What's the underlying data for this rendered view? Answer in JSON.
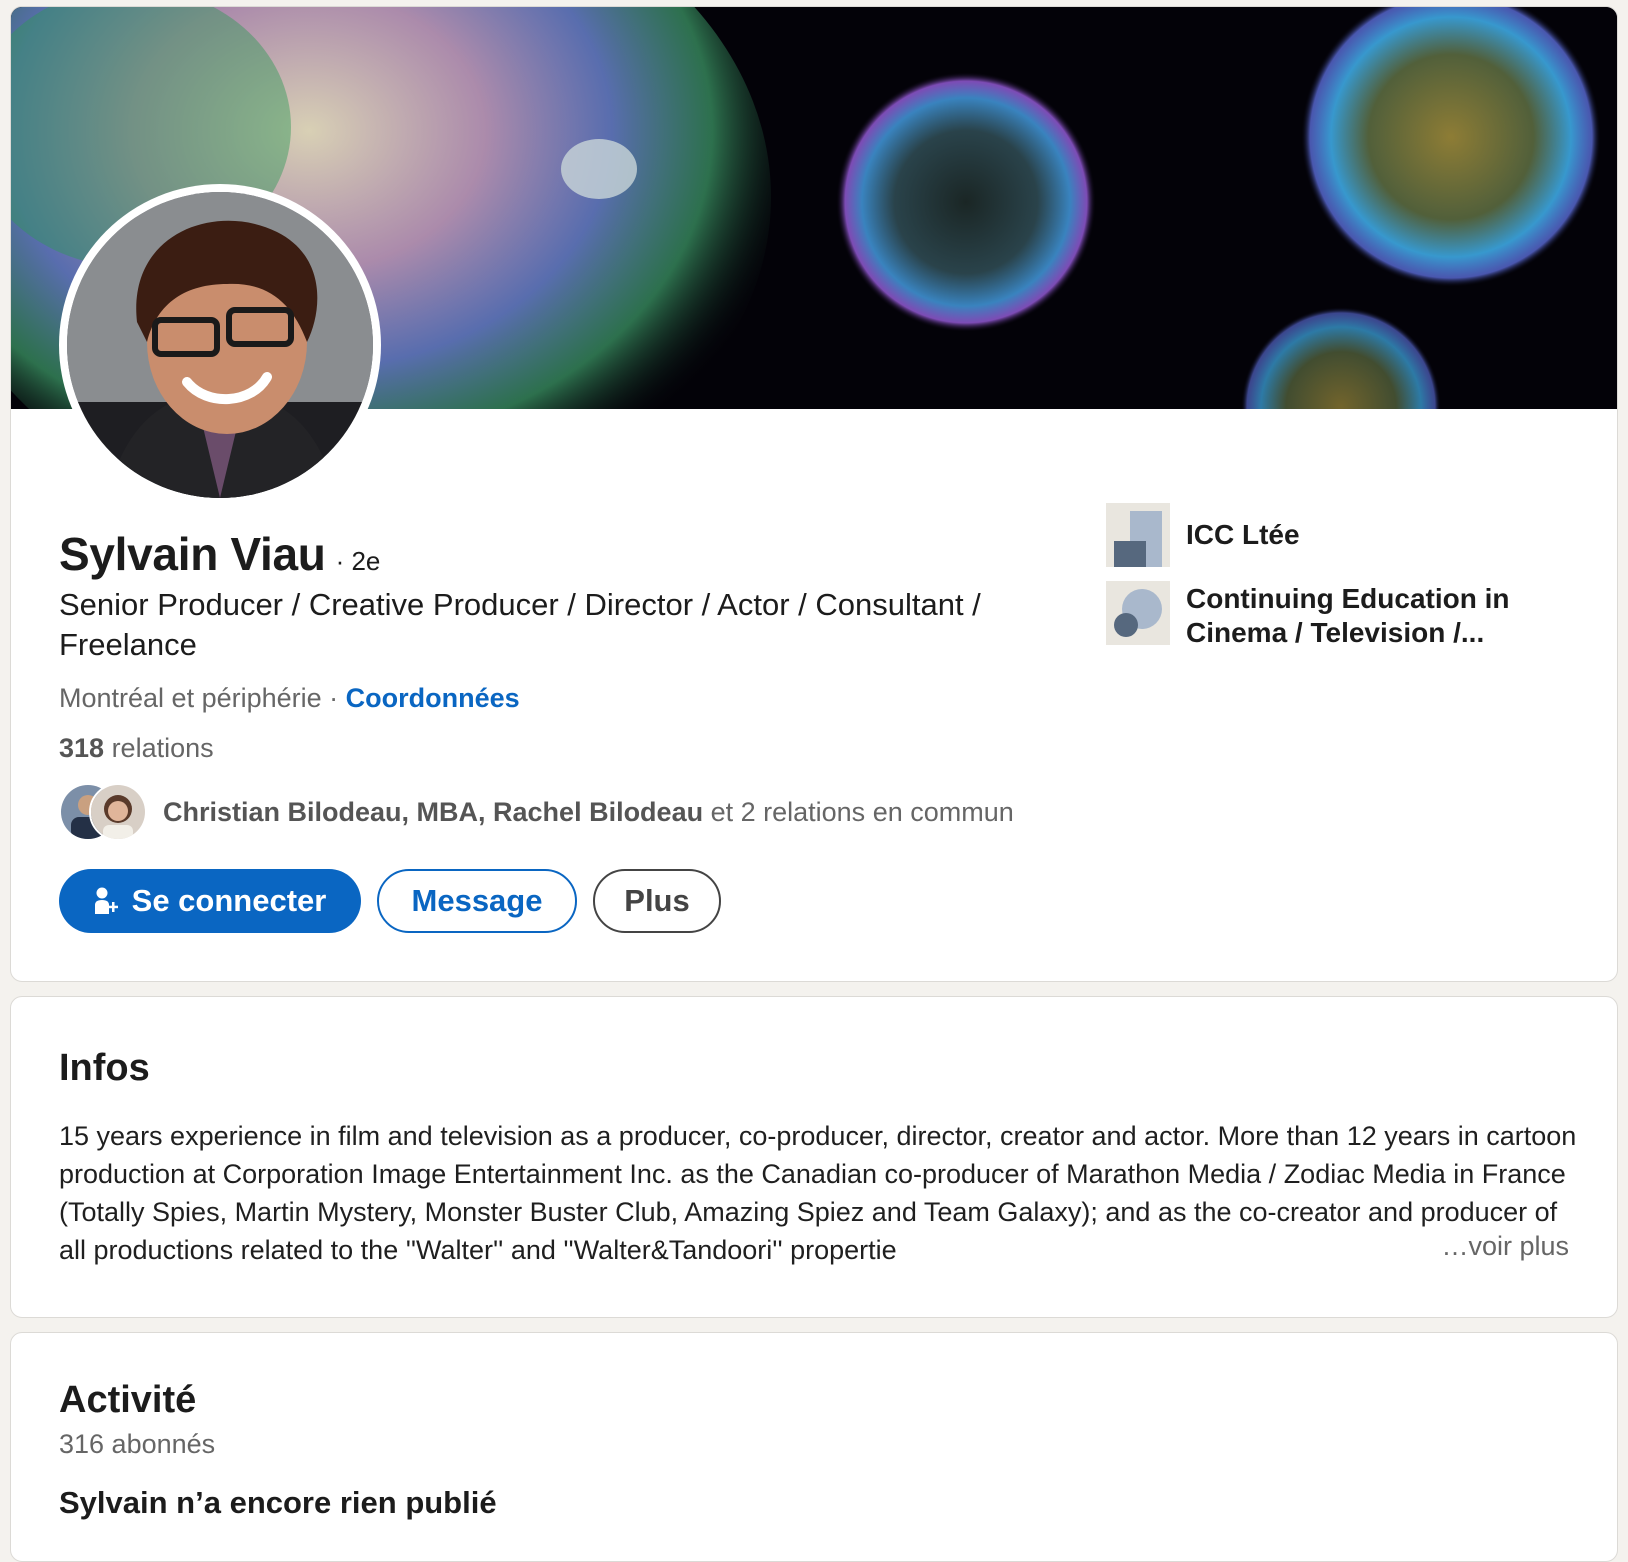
{
  "profile": {
    "name": "Sylvain Viau",
    "degree": "· 2e",
    "headline": "Senior Producer / Creative Producer / Director / Actor / Consultant / Freelance",
    "location": "Montréal et périphérie",
    "separator": " · ",
    "contact_link": "Coordonnées",
    "connections_count": "318",
    "connections_label": " relations",
    "mutual_names": "Christian Bilodeau, MBA, Rachel Bilodeau",
    "mutual_suffix": " et 2 relations en commun"
  },
  "actions": {
    "connect_label": "Se connecter",
    "message_label": "Message",
    "more_label": "Plus"
  },
  "companies": [
    {
      "name": "ICC Ltée",
      "icon": "company-logo-icon"
    },
    {
      "name": "Continuing Education in Cinema / Television /...",
      "icon": "school-logo-icon"
    }
  ],
  "about": {
    "title": "Infos",
    "text": "15 years experience in film and television as a producer, co-producer, director, creator and actor. More than 12 years in cartoon production at Corporation Image Entertainment Inc. as the Canadian co-producer of Marathon Media / Zodiac Media in France (Totally Spies, Martin Mystery, Monster Buster Club, Amazing Spiez and Team Galaxy); and as the co-creator and producer of all productions related to the ''Walter'' and ''Walter&Tandoori'' propertie",
    "see_more": "…voir plus"
  },
  "activity": {
    "title": "Activité",
    "followers": "316 abonnés",
    "empty_message": "Sylvain n’a encore rien publié"
  },
  "colors": {
    "accent": "#0a66c2",
    "background": "#f4f2ee",
    "card": "#ffffff"
  }
}
